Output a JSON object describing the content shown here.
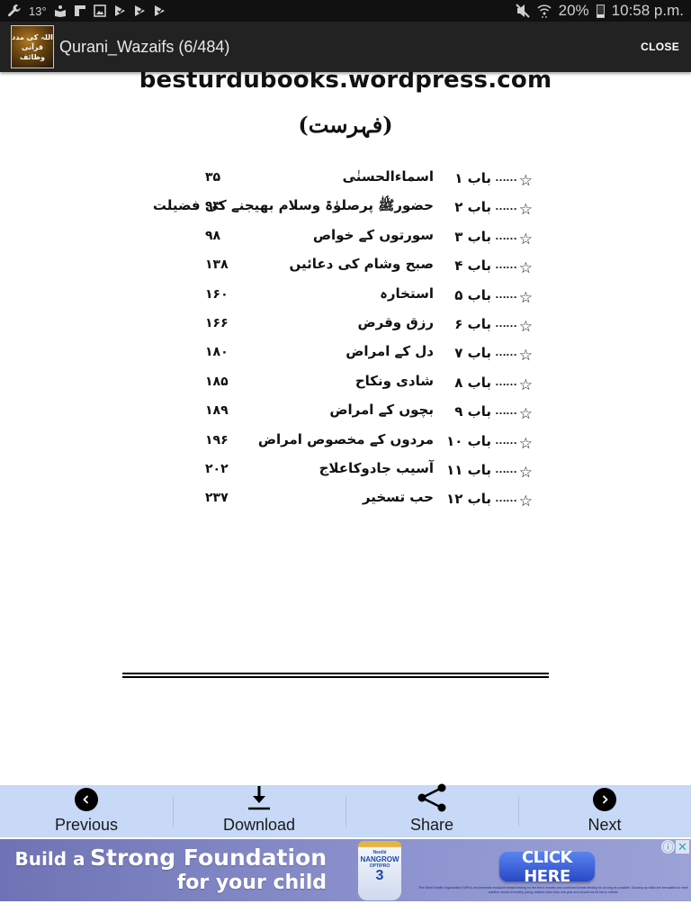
{
  "status_bar": {
    "left_icons": [
      "wrench-icon",
      "temperature-icon",
      "reader-icon",
      "screen-icon",
      "gallery-icon",
      "play-store-icon",
      "play-store-icon",
      "play-store-icon"
    ],
    "temperature": "13°",
    "battery": "20%",
    "battery_level": 0.2,
    "time": "10:58 p.m."
  },
  "app_bar": {
    "logo_text": [
      "اللہ کی مدد",
      "قرآنی",
      "وظائف"
    ],
    "title": "Qurani_Wazaifs (6/484)",
    "close_label": "CLOSE"
  },
  "page": {
    "watermark": "besturdubooks.wordpress.com",
    "toc_title": "(فہرست)",
    "toc": [
      {
        "chapter": "باب ۱",
        "topic": "اسماءالحسنٰی",
        "page": "۳۵"
      },
      {
        "chapter": "باب ۲",
        "topic": "حضورﷺ پرصلوٰۃ وسلام بھیجنے کی فضیلت",
        "page": "۹۳"
      },
      {
        "chapter": "باب ۳",
        "topic": "سورتوں کے خواص",
        "page": "۹۸"
      },
      {
        "chapter": "باب ۴",
        "topic": "صبح وشام کی دعائیں",
        "page": "۱۳۸"
      },
      {
        "chapter": "باب ۵",
        "topic": "استخارہ",
        "page": "۱۶۰"
      },
      {
        "chapter": "باب ۶",
        "topic": "رزق وقرض",
        "page": "۱۶۶"
      },
      {
        "chapter": "باب ۷",
        "topic": "دل کے امراض",
        "page": "۱۸۰"
      },
      {
        "chapter": "باب ۸",
        "topic": "شادی ونکاح",
        "page": "۱۸۵"
      },
      {
        "chapter": "باب ۹",
        "topic": "بچوں کے امراض",
        "page": "۱۸۹"
      },
      {
        "chapter": "باب ۱۰",
        "topic": "مردوں کے مخصوص امراض",
        "page": "۱۹۶"
      },
      {
        "chapter": "باب ۱۱",
        "topic": "آسیب جادوکاعلاج",
        "page": "۲۰۲"
      },
      {
        "chapter": "باب ۱۲",
        "topic": "حب تسخیر",
        "page": "۲۳۷"
      }
    ],
    "star": "☆",
    "dots": "……"
  },
  "nav": {
    "previous": "Previous",
    "download": "Download",
    "share": "Share",
    "next": "Next"
  },
  "ad": {
    "line1_small_a": "Build a",
    "line1_big": "Strong Foundation",
    "line2": "for your child",
    "product_brand_top": "Nestlé",
    "product_brand": "NANGROW",
    "product_sub": "OPTIPRO",
    "product_num": "3",
    "cta": "CLICK HERE",
    "disclaimer": "The World Health Organization (WHO) recommends exclusive breast feeding for the first 6 months and continued breast-feeding for as long as possible. Growing up milks are formulated to meet nutrition needs of healthy young children older than one year and should not be fed to infants.",
    "info_glyph": "ⓘ",
    "close_glyph": "✕"
  }
}
